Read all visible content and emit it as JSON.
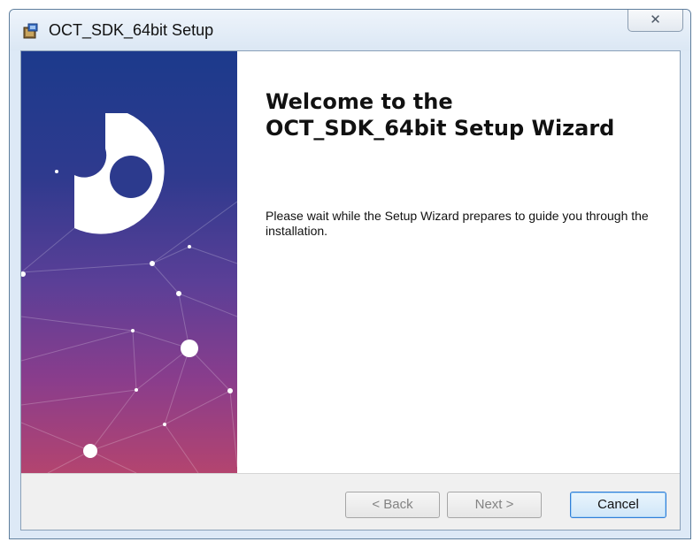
{
  "window": {
    "title": "OCT_SDK_64bit Setup",
    "close_glyph": "✕"
  },
  "icons": {
    "app": "installer-package-icon",
    "logo": "puzzle-logo-icon",
    "close": "close-icon"
  },
  "content": {
    "title_line1": "Welcome to the",
    "title_line2": "OCT_SDK_64bit Setup Wizard",
    "description": "Please wait while the Setup Wizard prepares to guide you through the installation."
  },
  "buttons": {
    "back": "< Back",
    "next": "Next >",
    "cancel": "Cancel"
  },
  "colors": {
    "panel_top": "#1c3a8c",
    "panel_bottom": "#b3446f",
    "focus_border": "#2f7ed8"
  }
}
